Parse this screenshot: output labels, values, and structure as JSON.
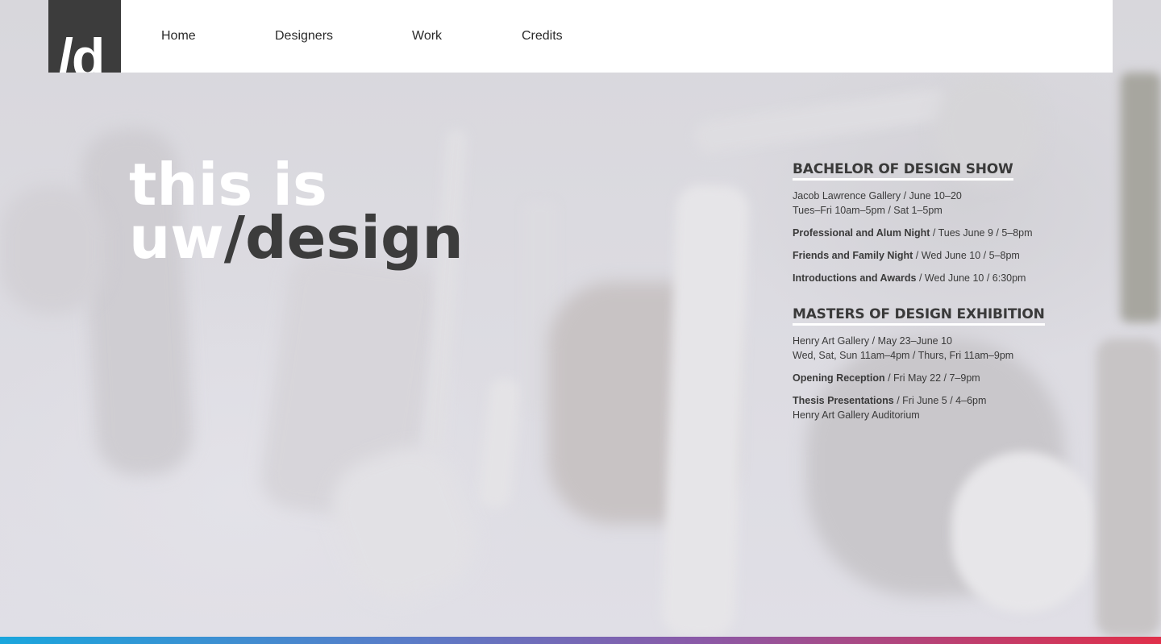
{
  "logo": {
    "text": "/d"
  },
  "nav": {
    "items": [
      {
        "label": "Home"
      },
      {
        "label": "Designers"
      },
      {
        "label": "Work"
      },
      {
        "label": "Credits"
      }
    ]
  },
  "hero": {
    "line1": "this is",
    "line2_light": "uw",
    "line2_dark": "/design"
  },
  "events": {
    "bachelor": {
      "heading": "BACHELOR OF DESIGN SHOW",
      "venue": "Jacob Lawrence Gallery / June 10–20",
      "hours": "Tues–Fri 10am–5pm / Sat 1–5pm",
      "items": [
        {
          "name": "Professional and Alum Night",
          "detail": " / Tues June 9 / 5–8pm"
        },
        {
          "name": "Friends and Family Night",
          "detail": " / Wed June 10 / 5–8pm"
        },
        {
          "name": "Introductions and Awards",
          "detail": " / Wed June 10 / 6:30pm"
        }
      ]
    },
    "masters": {
      "heading": "MASTERS OF DESIGN EXHIBITION",
      "venue": "Henry Art Gallery / May 23–June 10",
      "hours": "Wed, Sat, Sun 11am–4pm / Thurs, Fri 11am–9pm",
      "items": [
        {
          "name": "Opening Reception",
          "detail": " / Fri May 22 / 7–9pm"
        },
        {
          "name": "Thesis Presentations",
          "detail": " / Fri June 5 / 4–6pm",
          "extra": "Henry Art Gallery Auditorium"
        }
      ]
    }
  },
  "colors": {
    "dark": "#3c3c3c",
    "bar_start": "#1aa6dd",
    "bar_end": "#e0304a"
  }
}
